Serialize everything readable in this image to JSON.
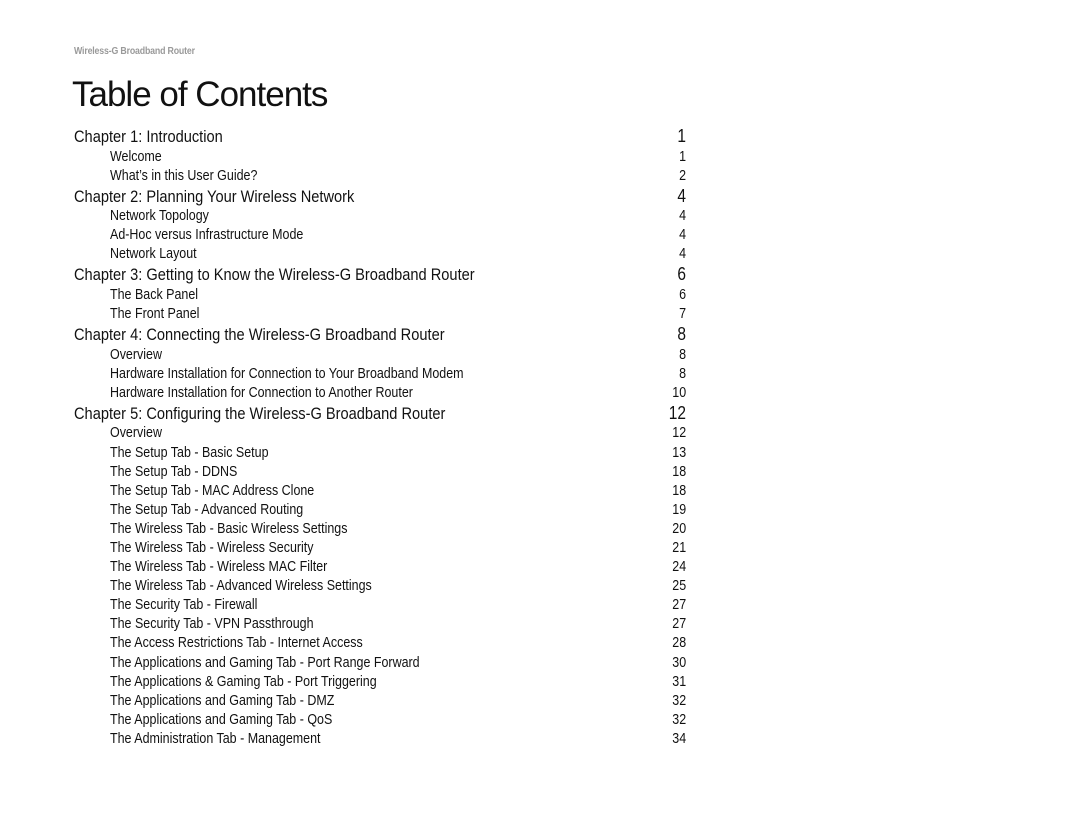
{
  "header": {
    "running_title": "Wireless-G Broadband Router"
  },
  "page_title": "Table of Contents",
  "chapters": [
    {
      "title": "Chapter 1: Introduction",
      "page": "1",
      "items": [
        {
          "title": "Welcome",
          "page": "1"
        },
        {
          "title": "What’s in this User Guide?",
          "page": "2"
        }
      ]
    },
    {
      "title": "Chapter 2: Planning Your Wireless Network",
      "page": "4",
      "items": [
        {
          "title": "Network Topology",
          "page": "4"
        },
        {
          "title": "Ad-Hoc versus Infrastructure Mode",
          "page": "4"
        },
        {
          "title": "Network Layout",
          "page": "4"
        }
      ]
    },
    {
      "title": "Chapter 3: Getting to Know the Wireless-G Broadband Router",
      "page": "6",
      "items": [
        {
          "title": "The Back Panel",
          "page": "6"
        },
        {
          "title": "The Front Panel",
          "page": "7"
        }
      ]
    },
    {
      "title": "Chapter 4: Connecting the Wireless-G Broadband Router",
      "page": "8",
      "items": [
        {
          "title": "Overview",
          "page": "8"
        },
        {
          "title": "Hardware Installation for Connection to Your Broadband Modem",
          "page": "8"
        },
        {
          "title": "Hardware Installation for Connection to Another Router",
          "page": "10"
        }
      ]
    },
    {
      "title": "Chapter 5: Configuring the Wireless-G Broadband Router",
      "page": "12",
      "items": [
        {
          "title": "Overview",
          "page": "12"
        },
        {
          "title": "The Setup Tab - Basic Setup",
          "page": "13"
        },
        {
          "title": "The Setup Tab - DDNS",
          "page": "18"
        },
        {
          "title": "The Setup Tab - MAC Address Clone",
          "page": "18"
        },
        {
          "title": "The Setup Tab - Advanced Routing",
          "page": "19"
        },
        {
          "title": "The Wireless Tab - Basic Wireless Settings",
          "page": "20"
        },
        {
          "title": "The Wireless Tab - Wireless Security",
          "page": "21"
        },
        {
          "title": "The Wireless Tab - Wireless MAC Filter",
          "page": "24"
        },
        {
          "title": "The Wireless Tab - Advanced Wireless Settings",
          "page": "25"
        },
        {
          "title": "The Security Tab - Firewall",
          "page": "27"
        },
        {
          "title": "The Security Tab - VPN Passthrough",
          "page": "27"
        },
        {
          "title": "The Access Restrictions Tab - Internet Access",
          "page": "28"
        },
        {
          "title": "The Applications and Gaming Tab - Port Range Forward",
          "page": "30"
        },
        {
          "title": "The Applications & Gaming Tab - Port Triggering",
          "page": "31"
        },
        {
          "title": "The Applications and Gaming Tab - DMZ",
          "page": "32"
        },
        {
          "title": "The Applications and Gaming Tab - QoS",
          "page": "32"
        },
        {
          "title": "The Administration Tab - Management",
          "page": "34"
        }
      ]
    }
  ]
}
